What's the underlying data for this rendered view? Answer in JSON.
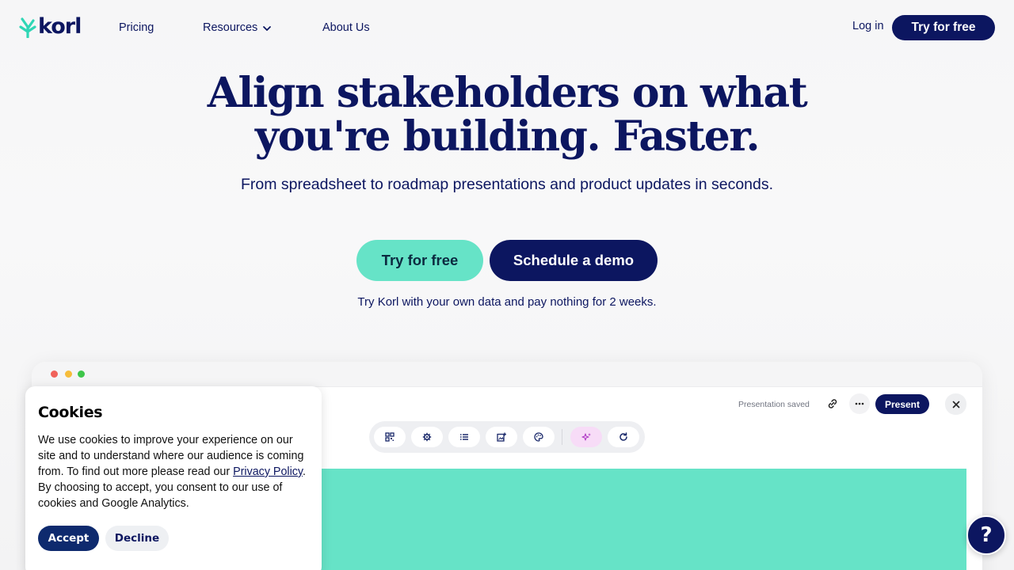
{
  "nav": {
    "logo_text": "korl",
    "pricing": "Pricing",
    "resources": "Resources",
    "about": "About Us",
    "login": "Log in",
    "cta": "Try for free"
  },
  "hero": {
    "title_line1": "Align stakeholders on what",
    "title_line2": "you're building. Faster.",
    "subtitle": "From spreadsheet to roadmap presentations and product updates in seconds.",
    "btn_trial": "Try for free",
    "btn_demo": "Schedule a demo",
    "note": "Try Korl with your own data and pay nothing for 2 weeks."
  },
  "mockup": {
    "status": "Presentation saved",
    "present": "Present",
    "toolbar_icons": [
      "grid-icon",
      "settings-icon",
      "list-icon",
      "add-image-icon",
      "palette-icon",
      "sparkle-icon",
      "refresh-icon"
    ]
  },
  "cookies": {
    "title": "Cookies",
    "text_before": "We use cookies to improve your experience on our site and to understand where our audience is coming from. To find out more please read our ",
    "link": "Privacy Policy",
    "text_after": ". By choosing to accept, you consent to our use of cookies and Google Analytics.",
    "accept": "Accept",
    "decline": "Decline"
  },
  "help": {
    "label": "?"
  },
  "colors": {
    "navy": "#0c1660",
    "mint": "#66e3c7"
  }
}
